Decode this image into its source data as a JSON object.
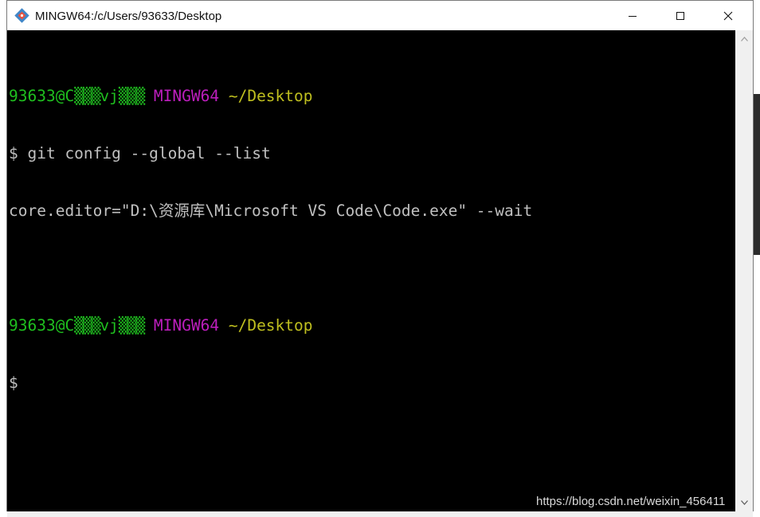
{
  "window": {
    "title": "MINGW64:/c/Users/93633/Desktop",
    "controls": {
      "minimize": "minimize",
      "maximize": "maximize",
      "close": "close"
    }
  },
  "terminal": {
    "prompt1": {
      "user": "93633@C",
      "obscured_a": "▒▒▒",
      "mid": "v",
      "host_j": "j",
      "obscured_b": "▒▒▒",
      "env": "MINGW64",
      "path": "~/Desktop"
    },
    "command": "$ git config --global --list",
    "output": "core.editor=\"D:\\资源库\\Microsoft VS Code\\Code.exe\" --wait",
    "prompt2": {
      "user": "93633@C",
      "obscured_a": "▒▒▒",
      "mid": "v",
      "host_j": "j",
      "obscured_b": "▒▒▒",
      "env": "MINGW64",
      "path": "~/Desktop"
    },
    "cursor_line": "$"
  },
  "watermark": "https://blog.csdn.net/weixin_456411",
  "colors": {
    "green": "#1fbf1f",
    "magenta": "#bd1ebd",
    "yellow": "#bfbf1f",
    "text": "#c0c0c0",
    "background": "#000000"
  }
}
